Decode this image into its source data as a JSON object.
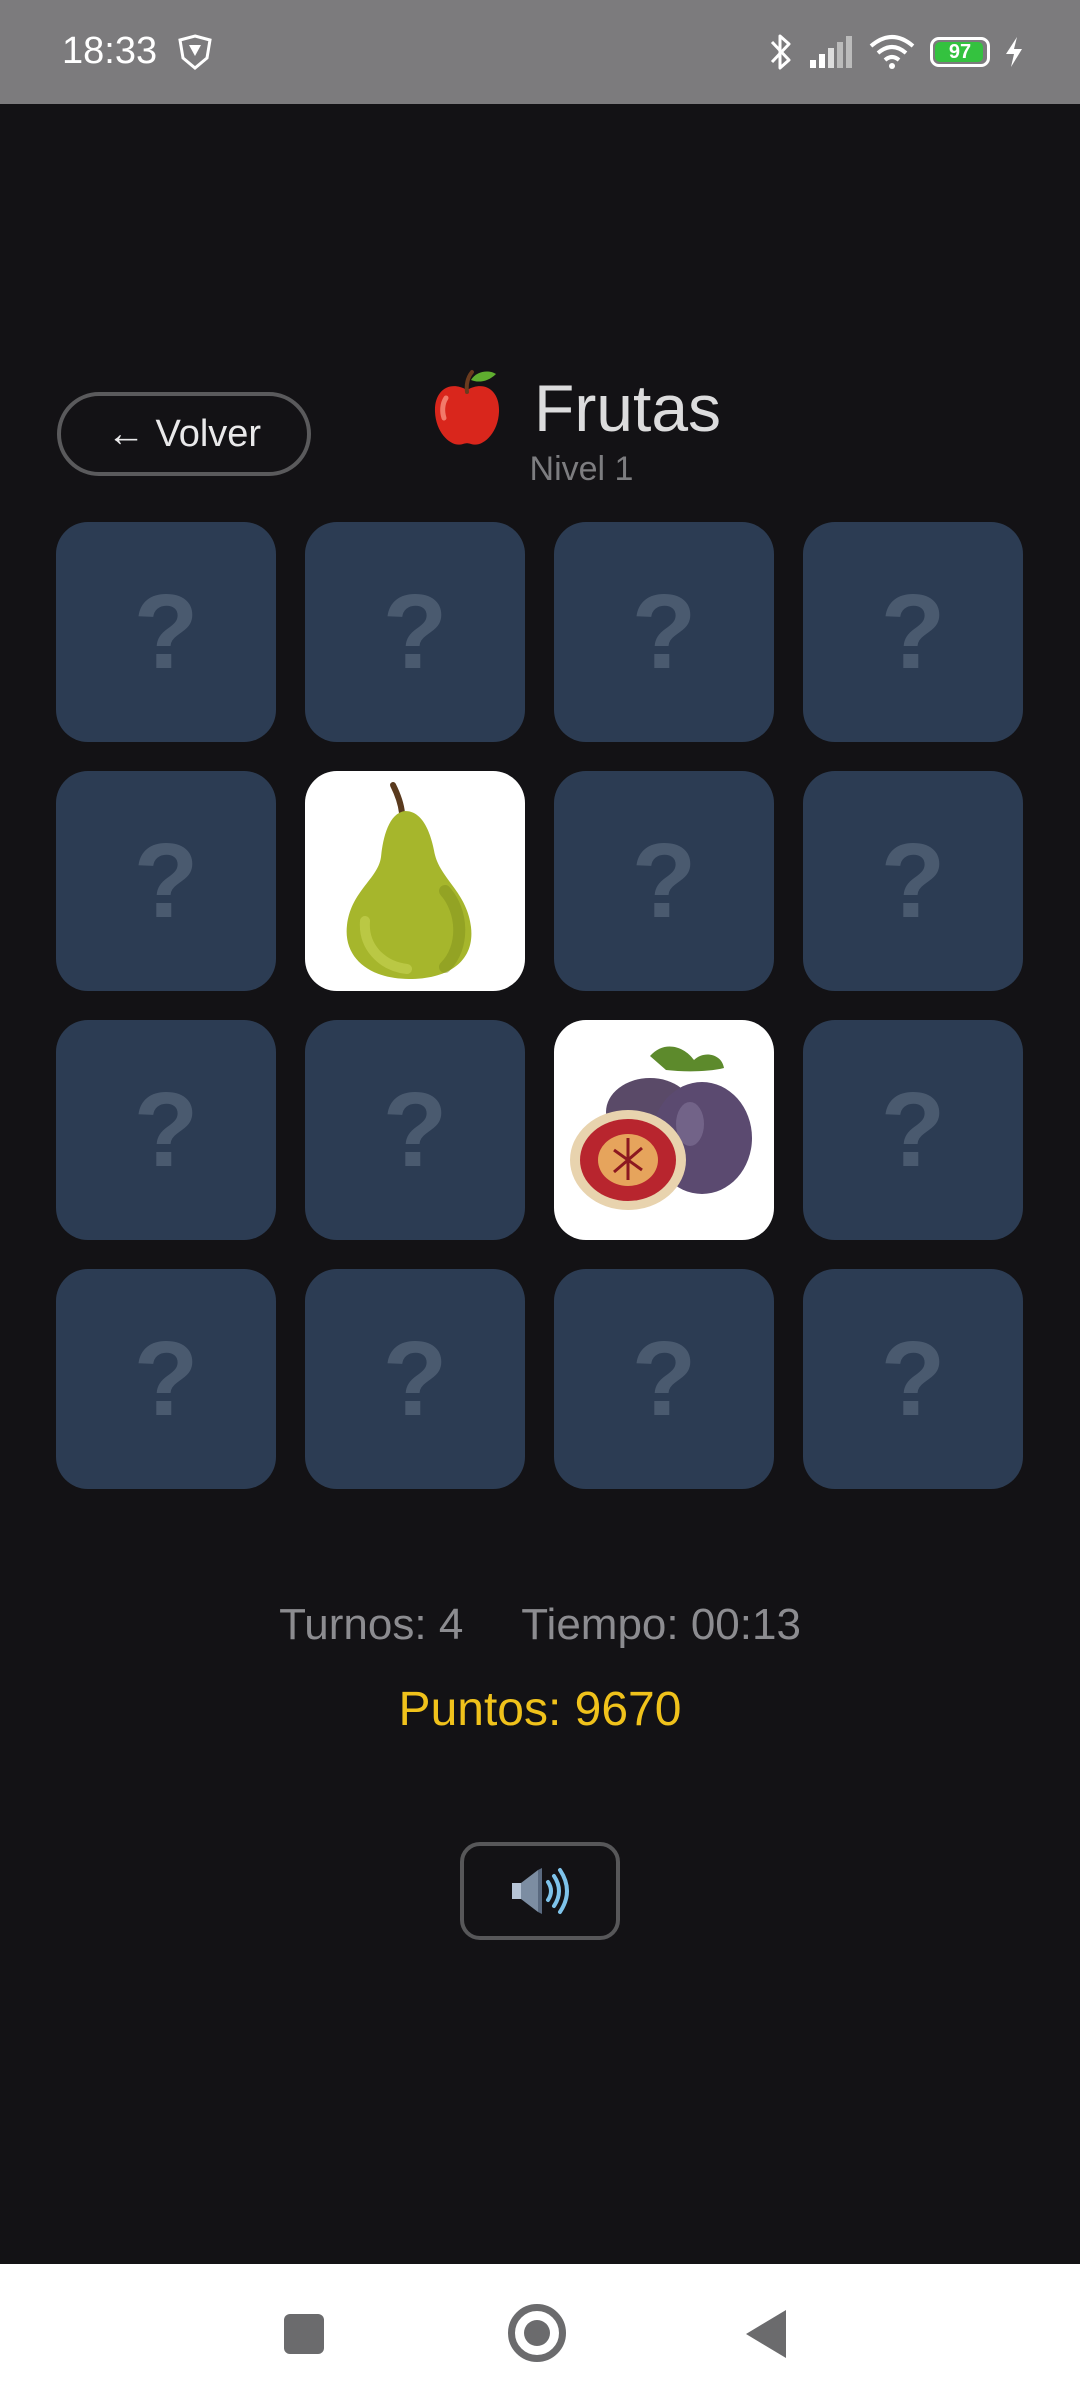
{
  "status_bar": {
    "time": "18:33",
    "battery": "97",
    "battery_level": 0.97
  },
  "header": {
    "back_label": "← Volver",
    "title": "Frutas",
    "subtitle": "Nivel 1",
    "title_icon": "red-apple-icon"
  },
  "board": {
    "columns": 4,
    "hidden_symbol": "?",
    "cards": [
      {
        "state": "hidden"
      },
      {
        "state": "hidden"
      },
      {
        "state": "hidden"
      },
      {
        "state": "hidden"
      },
      {
        "state": "hidden"
      },
      {
        "state": "revealed",
        "fruit": "pear"
      },
      {
        "state": "hidden"
      },
      {
        "state": "hidden"
      },
      {
        "state": "hidden"
      },
      {
        "state": "hidden"
      },
      {
        "state": "revealed",
        "fruit": "fig"
      },
      {
        "state": "hidden"
      },
      {
        "state": "hidden"
      },
      {
        "state": "hidden"
      },
      {
        "state": "hidden"
      },
      {
        "state": "hidden"
      }
    ]
  },
  "stats": {
    "turns": "Turnos: 4",
    "time": "Tiempo: 00:13",
    "score": "Puntos: 9670"
  },
  "controls": {
    "sound_icon": "speaker-icon"
  },
  "colors": {
    "background": "#131215",
    "card_back": "#2c3c53",
    "score": "#f0c21b"
  }
}
